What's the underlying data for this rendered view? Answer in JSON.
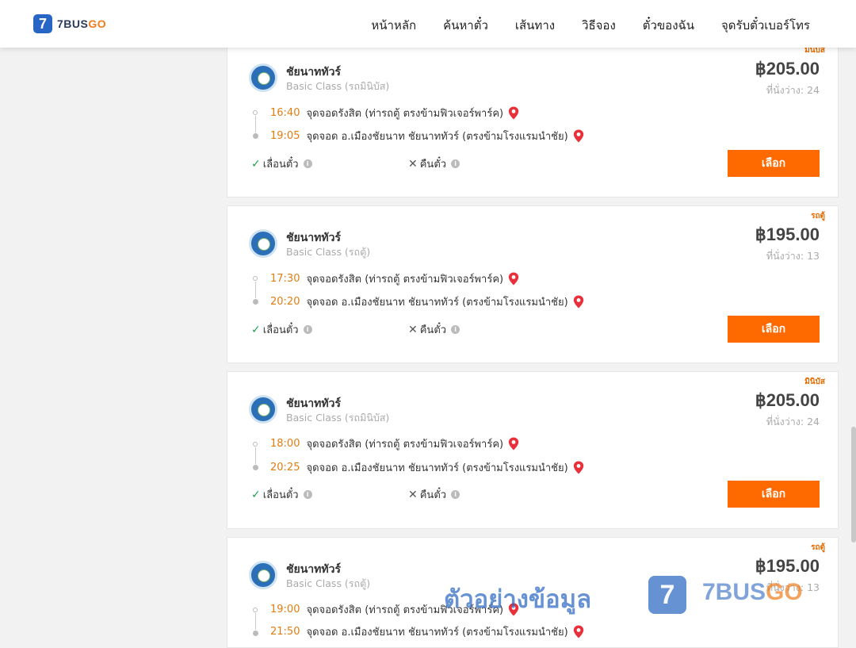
{
  "header": {
    "logo_mark": "7",
    "logo_text_a": "7BUS",
    "logo_text_b": "GO",
    "nav": [
      "หน้าหลัก",
      "ค้นหาตั๋ว",
      "เส้นทาง",
      "วิธีจอง",
      "ตั๋วของฉัน",
      "จุดรับตั๋วเบอร์โทร"
    ]
  },
  "trips": [
    {
      "tag": "มินิบัส",
      "operator": "ชัยนาททัวร์",
      "class": "Basic Class (รถมินิบัส)",
      "price": "฿205.00",
      "seats": "ที่นั่งว่าง: 24",
      "depart_time": "16:40",
      "depart_stop": "จุดจอดรังสิต (ท่ารถตู้ ตรงข้ามฟิวเจอร์พาร์ค)",
      "arrive_time": "19:05",
      "arrive_stop": "จุดจอด อ.เมืองชัยนาท ชัยนาททัวร์ (ตรงข้ามโรงแรมนำชัย)",
      "reschedule": "เลื่อนตั๋ว",
      "refund": "คืนตั๋ว",
      "select": "เลือก"
    },
    {
      "tag": "รถตู้",
      "operator": "ชัยนาททัวร์",
      "class": "Basic Class (รถตู้)",
      "price": "฿195.00",
      "seats": "ที่นั่งว่าง: 13",
      "depart_time": "17:30",
      "depart_stop": "จุดจอดรังสิต (ท่ารถตู้ ตรงข้ามฟิวเจอร์พาร์ค)",
      "arrive_time": "20:20",
      "arrive_stop": "จุดจอด อ.เมืองชัยนาท ชัยนาททัวร์ (ตรงข้ามโรงแรมนำชัย)",
      "reschedule": "เลื่อนตั๋ว",
      "refund": "คืนตั๋ว",
      "select": "เลือก"
    },
    {
      "tag": "มินิบัส",
      "operator": "ชัยนาททัวร์",
      "class": "Basic Class (รถมินิบัส)",
      "price": "฿205.00",
      "seats": "ที่นั่งว่าง: 24",
      "depart_time": "18:00",
      "depart_stop": "จุดจอดรังสิต (ท่ารถตู้ ตรงข้ามฟิวเจอร์พาร์ค)",
      "arrive_time": "20:25",
      "arrive_stop": "จุดจอด อ.เมืองชัยนาท ชัยนาททัวร์ (ตรงข้ามโรงแรมนำชัย)",
      "reschedule": "เลื่อนตั๋ว",
      "refund": "คืนตั๋ว",
      "select": "เลือก"
    },
    {
      "tag": "รถตู้",
      "operator": "ชัยนาททัวร์",
      "class": "Basic Class (รถตู้)",
      "price": "฿195.00",
      "seats": "ที่นั่งว่าง: 13",
      "depart_time": "19:00",
      "depart_stop": "จุดจอดรังสิต (ท่ารถตู้ ตรงข้ามฟิวเจอร์พาร์ค)",
      "arrive_time": "21:50",
      "arrive_stop": "จุดจอด อ.เมืองชัยนาท ชัยนาททัวร์ (ตรงข้ามโรงแรมนำชัย)",
      "reschedule": "",
      "refund": "",
      "select": ""
    }
  ],
  "watermark": {
    "text": "ตัวอย่างข้อมูล",
    "mark": "7",
    "brand_a": "7BUS",
    "brand_b": "GO"
  },
  "colors": {
    "accent_orange": "#ff6a00",
    "time_orange": "#e27d12",
    "brand_blue": "#2766c4"
  }
}
